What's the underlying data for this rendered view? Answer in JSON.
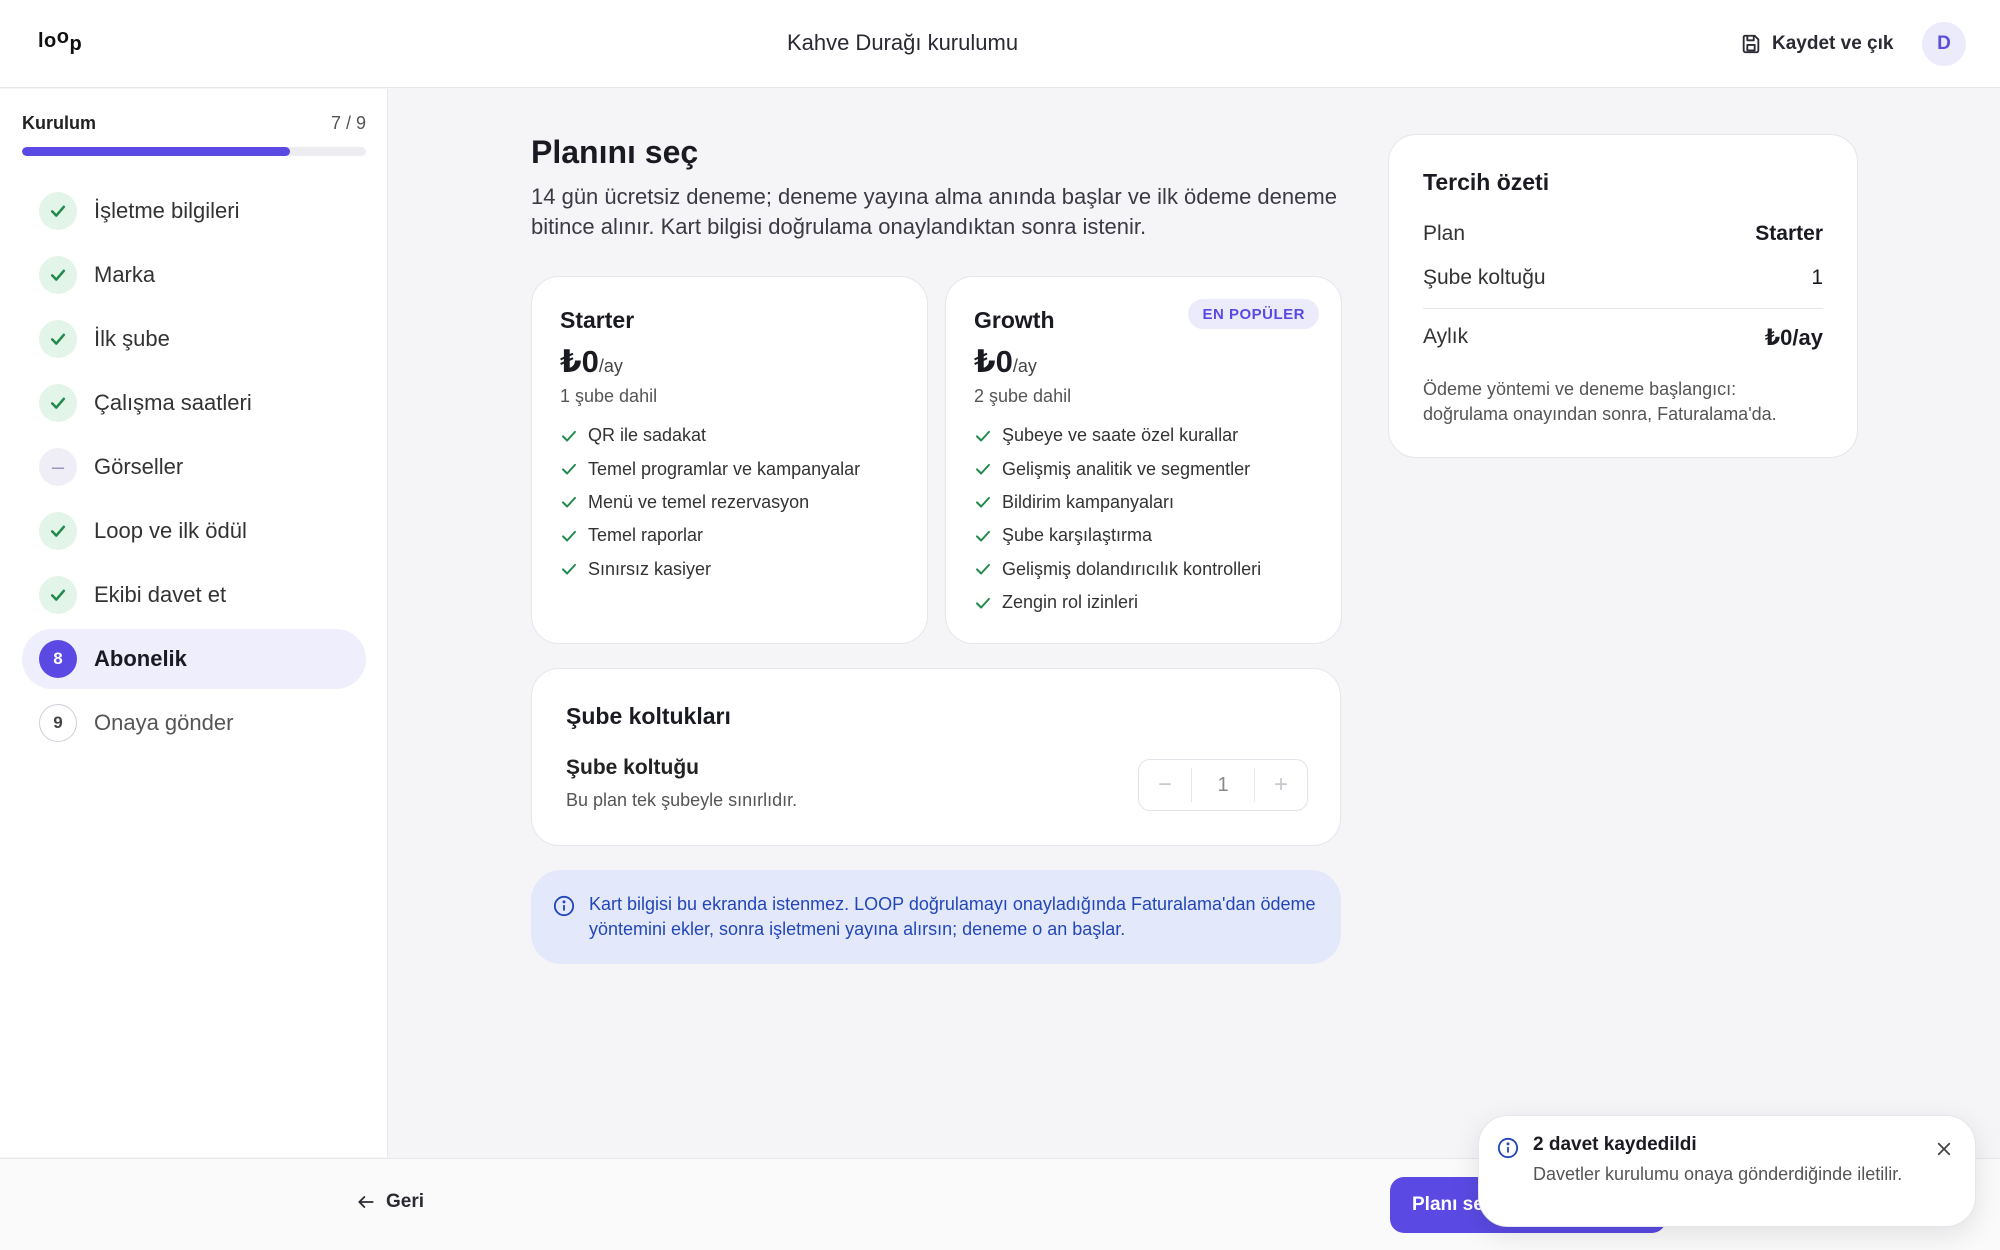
{
  "header": {
    "logo": "loop",
    "title": "Kahve Durağı kurulumu",
    "save_exit_label": "Kaydet ve çık",
    "save_icon": "save-icon",
    "avatar_initial": "D"
  },
  "sidebar": {
    "heading": "Kurulum",
    "progress_text": "7 / 9",
    "progress_fraction": 0.78,
    "steps": [
      {
        "label": "İşletme bilgileri",
        "status": "done"
      },
      {
        "label": "Marka",
        "status": "done"
      },
      {
        "label": "İlk şube",
        "status": "done"
      },
      {
        "label": "Çalışma saatleri",
        "status": "done"
      },
      {
        "label": "Görseller",
        "status": "skipped",
        "badge": "–"
      },
      {
        "label": "Loop ve ilk ödül",
        "status": "done"
      },
      {
        "label": "Ekibi davet et",
        "status": "done"
      },
      {
        "label": "Abonelik",
        "status": "current",
        "badge": "8"
      },
      {
        "label": "Onaya gönder",
        "status": "pending",
        "badge": "9"
      }
    ]
  },
  "main": {
    "title": "Planını seç",
    "description": "14 gün ücretsiz deneme; deneme yayına alma anında başlar ve ilk ödeme deneme bitince alınır. Kart bilgisi doğrulama onaylandıktan sonra istenir.",
    "plans": [
      {
        "name": "Starter",
        "price": "₺0",
        "period": "/ay",
        "branches": "1 şube dahil",
        "features": [
          "QR ile sadakat",
          "Temel programlar ve kampanyalar",
          "Menü ve temel rezervasyon",
          "Temel raporlar",
          "Sınırsız kasiyer"
        ]
      },
      {
        "name": "Growth",
        "price": "₺0",
        "period": "/ay",
        "branches": "2 şube dahil",
        "badge": "EN POPÜLER",
        "features": [
          "Şubeye ve saate özel kurallar",
          "Gelişmiş analitik ve segmentler",
          "Bildirim kampanyaları",
          "Şube karşılaştırma",
          "Gelişmiş dolandırıcılık kontrolleri",
          "Zengin rol izinleri"
        ]
      }
    ],
    "seats": {
      "title": "Şube koltukları",
      "label": "Şube koltuğu",
      "help": "Bu plan tek şubeyle sınırlıdır.",
      "value": "1",
      "minus": "−",
      "plus": "+"
    },
    "info": "Kart bilgisi bu ekranda istenmez. LOOP doğrulamayı onayladığında Faturalama'dan ödeme yöntemini ekler, sonra işletmeni yayına alırsın; deneme o an başlar."
  },
  "summary": {
    "title": "Tercih özeti",
    "plan_label": "Plan",
    "plan_value": "Starter",
    "seat_label": "Şube koltuğu",
    "seat_value": "1",
    "monthly_label": "Aylık",
    "monthly_value": "₺0/ay",
    "note": "Ödeme yöntemi ve deneme başlangıcı: doğrulama onayından sonra, Faturalama'da."
  },
  "footer": {
    "back_label": "Geri",
    "primary_label": "Planı seç"
  },
  "toast": {
    "title": "2 davet kaydedildi",
    "body": "Davetler kurulumu onaya gönderdiğinde iletilir."
  },
  "colors": {
    "accent": "#5a4ae3",
    "success": "#1f8a4c",
    "info_bg": "#e3e8fb",
    "info_text": "#2347b8"
  }
}
